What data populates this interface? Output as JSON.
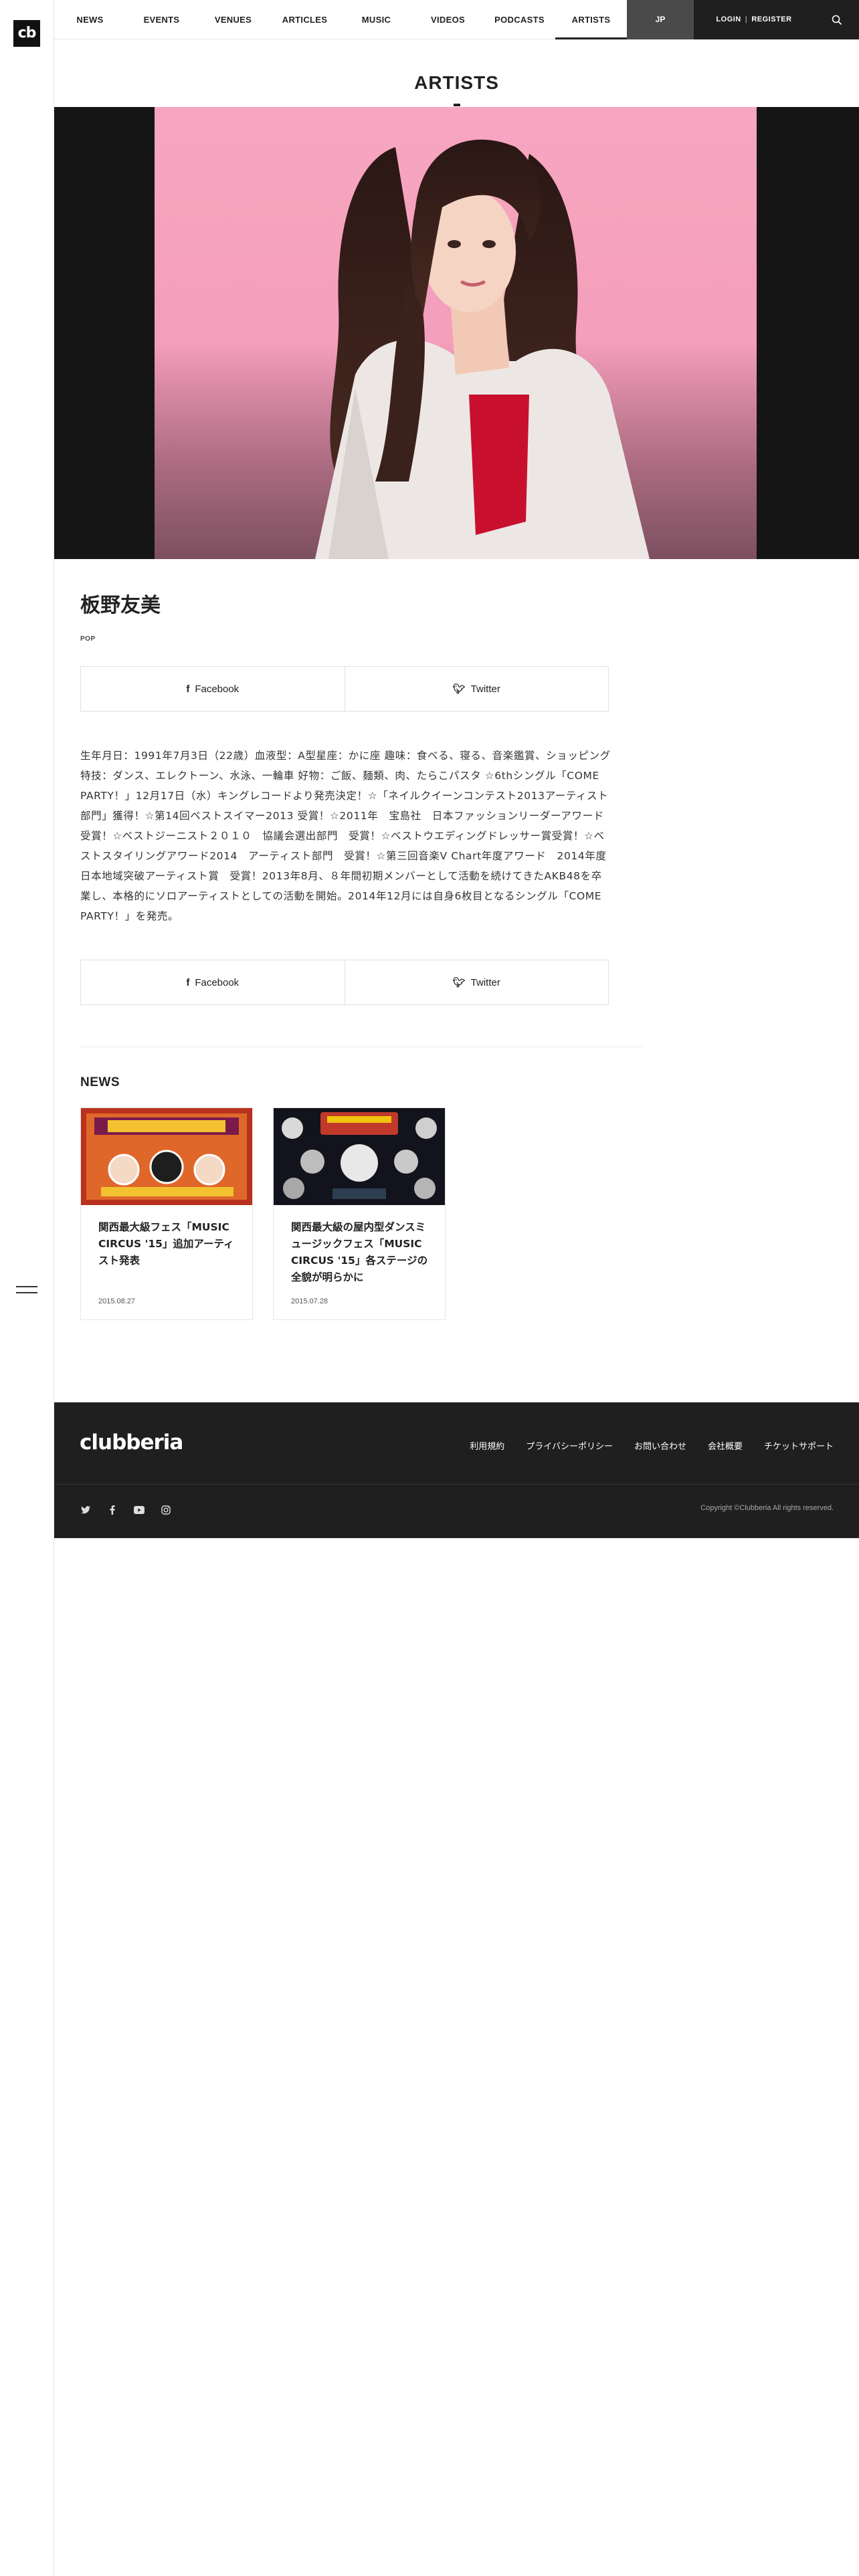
{
  "brand": {
    "logo": "cb",
    "footer_logo": "clubberia"
  },
  "nav": {
    "items": [
      "NEWS",
      "EVENTS",
      "VENUES",
      "ARTICLES",
      "MUSIC",
      "VIDEOS",
      "PODCASTS",
      "ARTISTS"
    ],
    "active": "ARTISTS",
    "lang": "JP",
    "login": "LOGIN",
    "register": "REGISTER"
  },
  "page": {
    "title": "ARTISTS"
  },
  "artist": {
    "name": "板野友美",
    "genre": "POP",
    "share": {
      "facebook": "Facebook",
      "twitter": "Twitter"
    },
    "bio": "生年月日：1991年7月3日（22歳）血液型：A型星座：かに座 趣味：食べる、寝る、音楽鑑賞、ショッピング 特技：ダンス、エレクトーン、水泳、一輪車 好物：ご飯、麺類、肉、たらこパスタ ☆6thシングル「COME PARTY！」12月17日（水）キングレコードより発売決定！☆「ネイルクイーンコンテスト2013アーティスト部門」獲得！☆第14回ベストスイマー2013 受賞！☆2011年　宝島社　日本ファッションリーダーアワード　受賞！☆ベストジーニスト２０１０　協議会選出部門　受賞！☆ベストウエディングドレッサー賞受賞！☆ベストスタイリングアワード2014　アーティスト部門　受賞！☆第三回音楽V Chart年度アワード　2014年度日本地域突破アーティスト賞　受賞！2013年8月、８年間初期メンバーとして活動を続けてきたAKB48を卒業し、本格的にソロアーティストとしての活動を開始。2014年12月には自身6枚目となるシングル「COME PARTY！」を発売。"
  },
  "news": {
    "heading": "NEWS",
    "items": [
      {
        "title": "関西最大級フェス「MUSIC CIRCUS '15」追加アーティスト発表",
        "date": "2015.08.27"
      },
      {
        "title": "関西最大級の屋内型ダンスミュージックフェス「MUSIC CIRCUS '15」各ステージの全貌が明らかに",
        "date": "2015.07.28"
      }
    ]
  },
  "footer": {
    "links": [
      "利用規約",
      "プライバシーポリシー",
      "お問い合わせ",
      "会社概要",
      "チケットサポート"
    ],
    "social": [
      "twitter-icon",
      "facebook-icon",
      "youtube-icon",
      "instagram-icon"
    ],
    "copyright": "Copyright ©Clubberia All rights reserved."
  },
  "colors": {
    "dark": "#1f1f1f",
    "lang_bg": "#4a4a4a",
    "hero_pink": "#f7a6c1"
  }
}
